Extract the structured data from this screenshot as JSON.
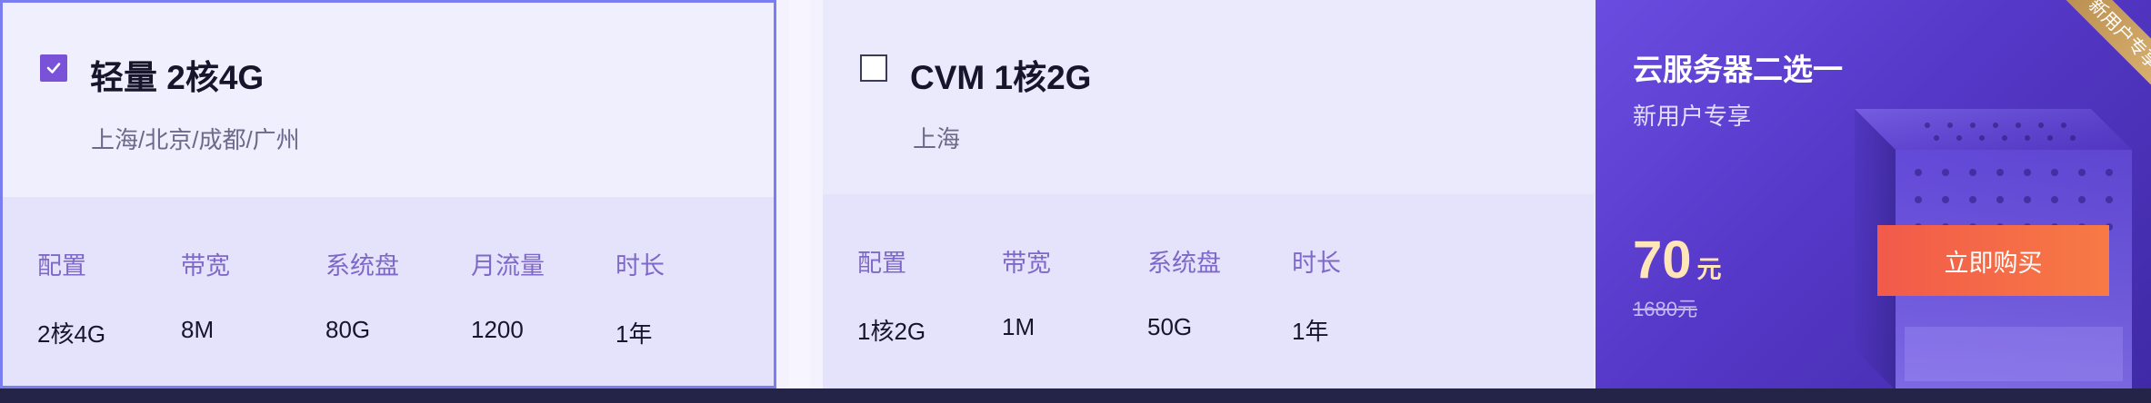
{
  "cards": [
    {
      "title": "轻量 2核4G",
      "region": "上海/北京/成都/广州",
      "checked": true,
      "specs": [
        {
          "label": "配置",
          "value": "2核4G"
        },
        {
          "label": "带宽",
          "value": "8M"
        },
        {
          "label": "系统盘",
          "value": "80G"
        },
        {
          "label": "月流量",
          "value": "1200"
        },
        {
          "label": "时长",
          "value": "1年"
        }
      ]
    },
    {
      "title": "CVM 1核2G",
      "region": "上海",
      "checked": false,
      "specs": [
        {
          "label": "配置",
          "value": "1核2G"
        },
        {
          "label": "带宽",
          "value": "1M"
        },
        {
          "label": "系统盘",
          "value": "50G"
        },
        {
          "label": "时长",
          "value": "1年"
        }
      ]
    }
  ],
  "promo": {
    "title": "云服务器二选一",
    "subtitle": "新用户专享",
    "ribbon": "新用户专享",
    "price": "70",
    "price_unit": "元",
    "original_price": "1680元",
    "buy_label": "立即购买"
  },
  "colors": {
    "accent": "#7a52d8",
    "border_selected": "#7b7ef0",
    "promo_bg": "#5638c8",
    "buy_button": "#f25a4a",
    "price": "#ffe5b8"
  }
}
